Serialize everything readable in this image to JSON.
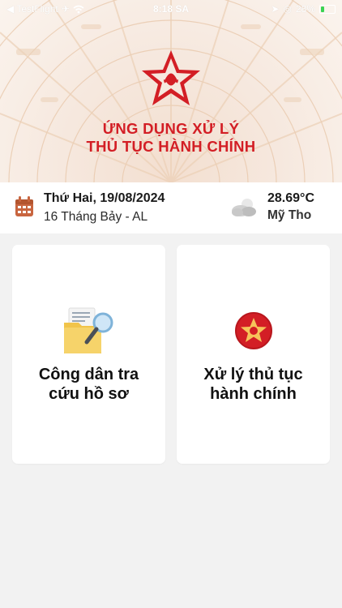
{
  "status_bar": {
    "back_app": "◀ TestFlight",
    "time": "8:18 SA",
    "battery": "28%",
    "battery_level": 0.28,
    "icons": [
      "airplane-icon",
      "wifi-icon",
      "location-icon",
      "alarm-icon",
      "battery-icon"
    ]
  },
  "header": {
    "title_line1": "ỨNG DỤNG XỬ LÝ",
    "title_line2": "THỦ TỤC HÀNH CHÍNH",
    "title_color": "#d31e25"
  },
  "info": {
    "date": "Thứ Hai, 19/08/2024",
    "lunar_date": "16 Tháng Bảy - AL",
    "temperature": "28.69°C",
    "city": "Mỹ Tho",
    "calendar_icon_color": "#c8653f"
  },
  "cards": [
    {
      "label_line1": "Công dân tra",
      "label_line2": "cứu hồ sơ",
      "icon": "folder-search-icon"
    },
    {
      "label_line1": "Xử lý thủ tục",
      "label_line2": "hành chính",
      "icon": "star-emblem-icon"
    }
  ]
}
